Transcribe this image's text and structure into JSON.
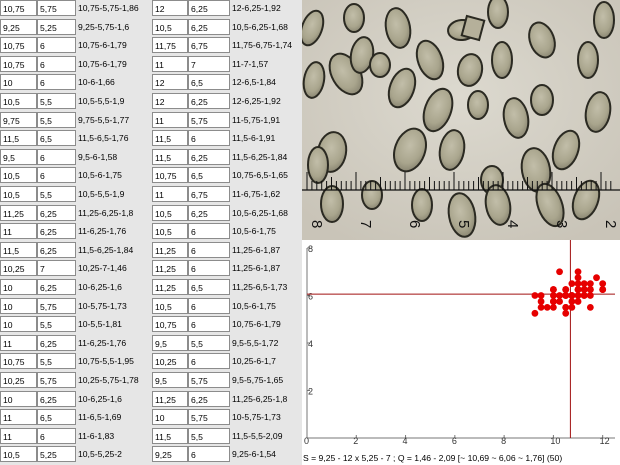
{
  "rows": [
    [
      "10,75",
      "5,75",
      "10,75-5,75-1,86",
      "12",
      "6,25",
      "12-6,25-1,92"
    ],
    [
      "9,25",
      "5,25",
      "9,25-5,75-1,6",
      "10,5",
      "6,25",
      "10,5-6,25-1,68"
    ],
    [
      "10,75",
      "6",
      "10,75-6-1,79",
      "11,75",
      "6,75",
      "11,75-6,75-1,74"
    ],
    [
      "10,75",
      "6",
      "10,75-6-1,79",
      "11",
      "7",
      "11-7-1,57"
    ],
    [
      "10",
      "6",
      "10-6-1,66",
      "12",
      "6,5",
      "12-6,5-1,84"
    ],
    [
      "10,5",
      "5,5",
      "10,5-5,5-1,9",
      "12",
      "6,25",
      "12-6,25-1,92"
    ],
    [
      "9,75",
      "5,5",
      "9,75-5,5-1,77",
      "11",
      "5,75",
      "11-5,75-1,91"
    ],
    [
      "11,5",
      "6,5",
      "11,5-6,5-1,76",
      "11,5",
      "6",
      "11,5-6-1,91"
    ],
    [
      "9,5",
      "6",
      "9,5-6-1,58",
      "11,5",
      "6,25",
      "11,5-6,25-1,84"
    ],
    [
      "10,5",
      "6",
      "10,5-6-1,75",
      "10,75",
      "6,5",
      "10,75-6,5-1,65"
    ],
    [
      "10,5",
      "5,5",
      "10,5-5,5-1,9",
      "11",
      "6,75",
      "11-6,75-1,62"
    ],
    [
      "11,25",
      "6,25",
      "11,25-6,25-1,8",
      "10,5",
      "6,25",
      "10,5-6,25-1,68"
    ],
    [
      "11",
      "6,25",
      "11-6,25-1,76",
      "10,5",
      "6",
      "10,5-6-1,75"
    ],
    [
      "11,5",
      "6,25",
      "11,5-6,25-1,84",
      "11,25",
      "6",
      "11,25-6-1,87"
    ],
    [
      "10,25",
      "7",
      "10,25-7-1,46",
      "11,25",
      "6",
      "11,25-6-1,87"
    ],
    [
      "10",
      "6,25",
      "10-6,25-1,6",
      "11,25",
      "6,5",
      "11,25-6,5-1,73"
    ],
    [
      "10",
      "5,75",
      "10-5,75-1,73",
      "10,5",
      "6",
      "10,5-6-1,75"
    ],
    [
      "10",
      "5,5",
      "10-5,5-1,81",
      "10,75",
      "6",
      "10,75-6-1,79"
    ],
    [
      "11",
      "6,25",
      "11-6,25-1,76",
      "9,5",
      "5,5",
      "9,5-5,5-1,72"
    ],
    [
      "10,75",
      "5,5",
      "10,75-5,5-1,95",
      "10,25",
      "6",
      "10,25-6-1,7"
    ],
    [
      "10,25",
      "5,75",
      "10,25-5,75-1,78",
      "9,5",
      "5,75",
      "9,5-5,75-1,65"
    ],
    [
      "10",
      "6,25",
      "10-6,25-1,6",
      "11,25",
      "6,25",
      "11,25-6,25-1,8"
    ],
    [
      "11",
      "6,5",
      "11-6,5-1,69",
      "10",
      "5,75",
      "10-5,75-1,73"
    ],
    [
      "11",
      "6",
      "11-6-1,83",
      "11,5",
      "5,5",
      "11,5-5,5-2,09"
    ],
    [
      "10,5",
      "5,25",
      "10,5-5,25-2",
      "9,25",
      "6",
      "9,25-6-1,54"
    ]
  ],
  "scale_labels": [
    "8",
    "7",
    "6",
    "5",
    "4",
    "3",
    "2"
  ],
  "chart_data": {
    "type": "scatter",
    "title": "",
    "xlabel": "",
    "ylabel": "",
    "xlim": [
      0,
      12.5
    ],
    "ylim": [
      0,
      8
    ],
    "x_ticks": [
      "0",
      "2",
      "4",
      "6",
      "8",
      "10",
      "12"
    ],
    "y_ticks": [
      "2",
      "4",
      "6",
      "8"
    ],
    "point_color": "#e60000",
    "crosshair_color": "#a01010",
    "crosshair": {
      "x": 10.69,
      "y": 6.06
    },
    "points": [
      [
        10.75,
        5.75
      ],
      [
        12,
        6.25
      ],
      [
        9.25,
        5.25
      ],
      [
        10.5,
        6.25
      ],
      [
        10.75,
        6
      ],
      [
        11.75,
        6.75
      ],
      [
        10.75,
        6
      ],
      [
        11,
        7
      ],
      [
        10,
        6
      ],
      [
        12,
        6.5
      ],
      [
        10.5,
        5.5
      ],
      [
        12,
        6.25
      ],
      [
        9.75,
        5.5
      ],
      [
        11,
        5.75
      ],
      [
        11.5,
        6.5
      ],
      [
        11.5,
        6
      ],
      [
        9.5,
        6
      ],
      [
        11.5,
        6.25
      ],
      [
        10.5,
        6
      ],
      [
        10.75,
        6.5
      ],
      [
        10.5,
        5.5
      ],
      [
        11,
        6.75
      ],
      [
        11.25,
        6.25
      ],
      [
        10.5,
        6.25
      ],
      [
        11,
        6.25
      ],
      [
        10.5,
        6
      ],
      [
        11.5,
        6.25
      ],
      [
        11.25,
        6
      ],
      [
        10.25,
        7
      ],
      [
        11.25,
        6
      ],
      [
        10,
        6.25
      ],
      [
        11.25,
        6.5
      ],
      [
        10,
        5.75
      ],
      [
        10.5,
        6
      ],
      [
        10,
        5.5
      ],
      [
        10.75,
        6
      ],
      [
        11,
        6.25
      ],
      [
        9.5,
        5.5
      ],
      [
        10.75,
        5.5
      ],
      [
        10.25,
        6
      ],
      [
        10.25,
        5.75
      ],
      [
        9.5,
        5.75
      ],
      [
        10,
        6.25
      ],
      [
        11.25,
        6.25
      ],
      [
        11,
        6.5
      ],
      [
        10,
        5.75
      ],
      [
        11,
        6
      ],
      [
        11.5,
        5.5
      ],
      [
        10.5,
        5.25
      ],
      [
        9.25,
        6
      ]
    ]
  },
  "caption": "S = 9,25 - 12 x 5,25 - 7 ; Q = 1,46 - 2,09 [~ 10,69 ~ 6,06 ~ 1,76] (50)"
}
